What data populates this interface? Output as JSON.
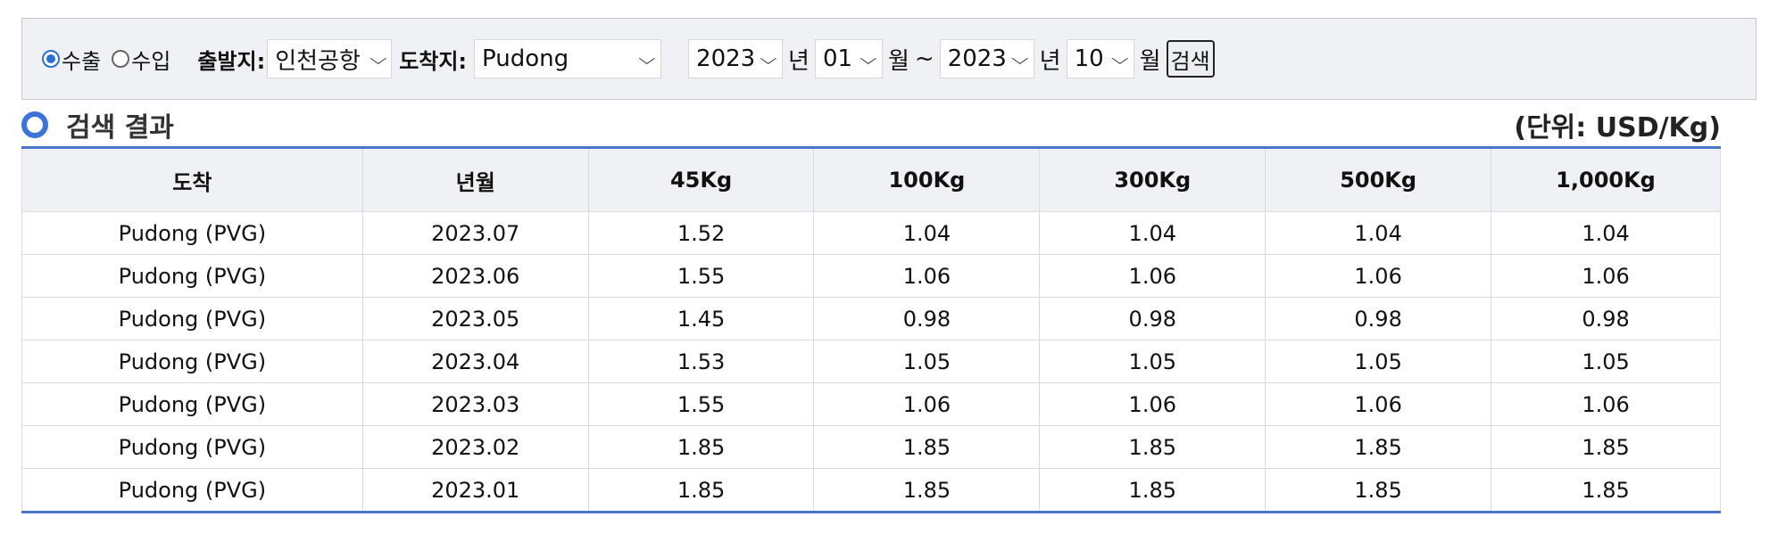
{
  "filters": {
    "export_label": "수출",
    "import_label": "수입",
    "origin_label": "출발지:",
    "origin_value": "인천공항",
    "destination_label": "도착지:",
    "destination_value": "Pudong",
    "start_year": "2023",
    "year_unit": "년",
    "start_month": "01",
    "month_unit": "월",
    "range_sep": "~",
    "end_year": "2023",
    "end_month": "10",
    "search_button": "검색"
  },
  "result": {
    "title": "검색 결과",
    "unit_note": "(단위: USD/Kg)"
  },
  "table": {
    "headers": [
      "도착",
      "년월",
      "45Kg",
      "100Kg",
      "300Kg",
      "500Kg",
      "1,000Kg"
    ],
    "rows": [
      [
        "Pudong (PVG)",
        "2023.07",
        "1.52",
        "1.04",
        "1.04",
        "1.04",
        "1.04"
      ],
      [
        "Pudong (PVG)",
        "2023.06",
        "1.55",
        "1.06",
        "1.06",
        "1.06",
        "1.06"
      ],
      [
        "Pudong (PVG)",
        "2023.05",
        "1.45",
        "0.98",
        "0.98",
        "0.98",
        "0.98"
      ],
      [
        "Pudong (PVG)",
        "2023.04",
        "1.53",
        "1.05",
        "1.05",
        "1.05",
        "1.05"
      ],
      [
        "Pudong (PVG)",
        "2023.03",
        "1.55",
        "1.06",
        "1.06",
        "1.06",
        "1.06"
      ],
      [
        "Pudong (PVG)",
        "2023.02",
        "1.85",
        "1.85",
        "1.85",
        "1.85",
        "1.85"
      ],
      [
        "Pudong (PVG)",
        "2023.01",
        "1.85",
        "1.85",
        "1.85",
        "1.85",
        "1.85"
      ]
    ]
  },
  "colors": {
    "accent": "#3b73d6",
    "header_bg": "#f0f1f5"
  }
}
